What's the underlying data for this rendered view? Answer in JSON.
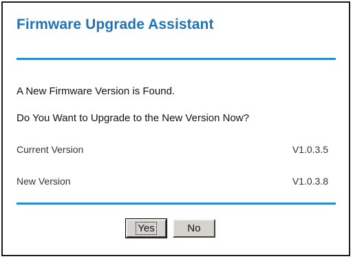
{
  "dialog": {
    "title": "Firmware Upgrade Assistant",
    "message": "A New Firmware Version is Found.",
    "question": "Do You Want to Upgrade to the New Version Now?",
    "current_version_label": "Current Version",
    "current_version_value": "V1.0.3.5",
    "new_version_label": "New Version",
    "new_version_value": "V1.0.3.8",
    "yes_label": "Yes",
    "no_label": "No"
  },
  "colors": {
    "title": "#1f74b8",
    "rule": "#2a8ccc",
    "button_face": "#d6d3ce",
    "border": "#1a1a1a"
  }
}
